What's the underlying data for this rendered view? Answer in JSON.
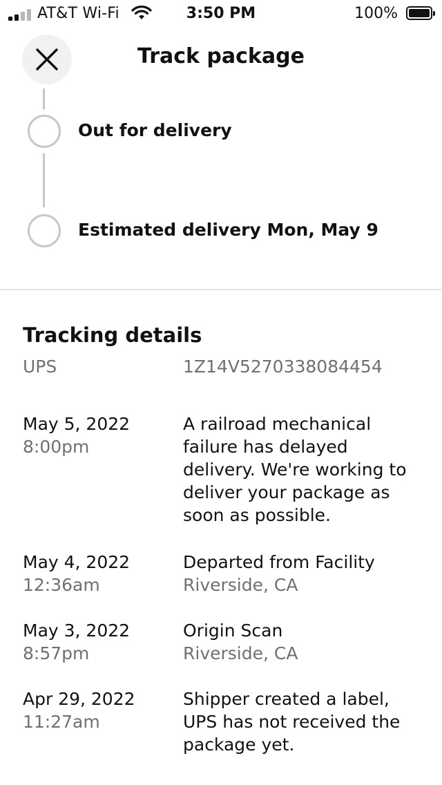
{
  "status_bar": {
    "carrier": "AT&T Wi-Fi",
    "time": "3:50 PM",
    "battery": "100%"
  },
  "header": {
    "title": "Track package",
    "close_icon": "close-icon"
  },
  "timeline": [
    {
      "label": "Out for delivery"
    },
    {
      "label": "Estimated delivery Mon, May 9"
    }
  ],
  "details": {
    "title": "Tracking details",
    "carrier": "UPS",
    "tracking_number": "1Z14V5270338084454",
    "events": [
      {
        "date": "May 5, 2022",
        "time": "8:00pm",
        "description": "A railroad mechanical failure has delayed delivery. We're working to deliver your package as soon as possible.",
        "location": ""
      },
      {
        "date": "May 4, 2022",
        "time": "12:36am",
        "description": "Departed from Facility",
        "location": "Riverside, CA"
      },
      {
        "date": "May 3, 2022",
        "time": "8:57pm",
        "description": "Origin Scan",
        "location": "Riverside, CA"
      },
      {
        "date": "Apr 29, 2022",
        "time": "11:27am",
        "description": "Shipper created a label, UPS has not received the package yet.",
        "location": ""
      }
    ]
  },
  "colors": {
    "primary_text": "#111111",
    "secondary_text": "#707070",
    "timeline_gray": "#c7c7c7",
    "close_button_bg": "#f1f1f1"
  }
}
